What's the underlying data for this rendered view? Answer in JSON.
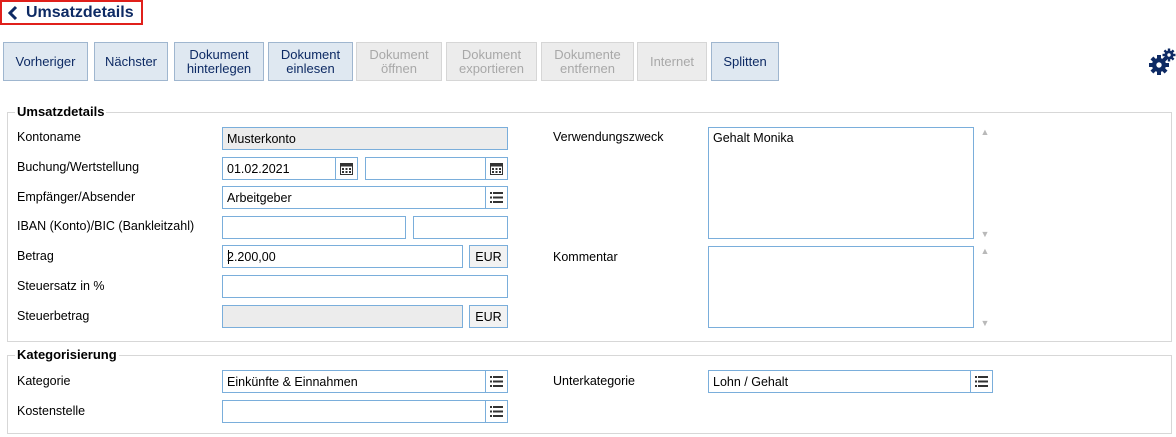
{
  "header": {
    "title": "Umsatzdetails"
  },
  "toolbar": {
    "prev": "Vorheriger",
    "next": "Nächster",
    "doc_store_1": "Dokument",
    "doc_store_2": "hinterlegen",
    "doc_read_1": "Dokument",
    "doc_read_2": "einlesen",
    "doc_open_1": "Dokument",
    "doc_open_2": "öffnen",
    "doc_export_1": "Dokument",
    "doc_export_2": "exportieren",
    "docs_remove_1": "Dokumente",
    "docs_remove_2": "entfernen",
    "internet": "Internet",
    "split": "Splitten"
  },
  "details": {
    "legend": "Umsatzdetails",
    "kontoname_label": "Kontoname",
    "kontoname_value": "Musterkonto",
    "buchung_label": "Buchung/Wertstellung",
    "buchung_date": "01.02.2021",
    "wertstellung_date": "",
    "empfaenger_label": "Empfänger/Absender",
    "empfaenger_value": "Arbeitgeber",
    "iban_label": "IBAN (Konto)/BIC (Bankleitzahl)",
    "iban_value": "",
    "bic_value": "",
    "betrag_label": "Betrag",
    "betrag_value": "2.200,00",
    "betrag_currency": "EUR",
    "steuersatz_label": "Steuersatz in %",
    "steuersatz_value": "",
    "steuerbetrag_label": "Steuerbetrag",
    "steuerbetrag_value": "",
    "steuerbetrag_currency": "EUR",
    "verwendungszweck_label": "Verwendungszweck",
    "verwendungszweck_value": "Gehalt Monika",
    "kommentar_label": "Kommentar",
    "kommentar_value": ""
  },
  "category": {
    "legend": "Kategorisierung",
    "kategorie_label": "Kategorie",
    "kategorie_value": "Einkünfte & Einnahmen",
    "unterkategorie_label": "Unterkategorie",
    "unterkategorie_value": "Lohn / Gehalt",
    "kostenstelle_label": "Kostenstelle",
    "kostenstelle_value": ""
  },
  "icons": {
    "back": "chevron-left-icon",
    "settings": "gears-icon",
    "calendar": "calendar-icon",
    "list": "list-picker-icon"
  },
  "colors": {
    "title": "#0d2a64",
    "highlight_border": "#e0201b",
    "button_bg": "#dfe8f1",
    "field_border": "#7aaedb"
  }
}
